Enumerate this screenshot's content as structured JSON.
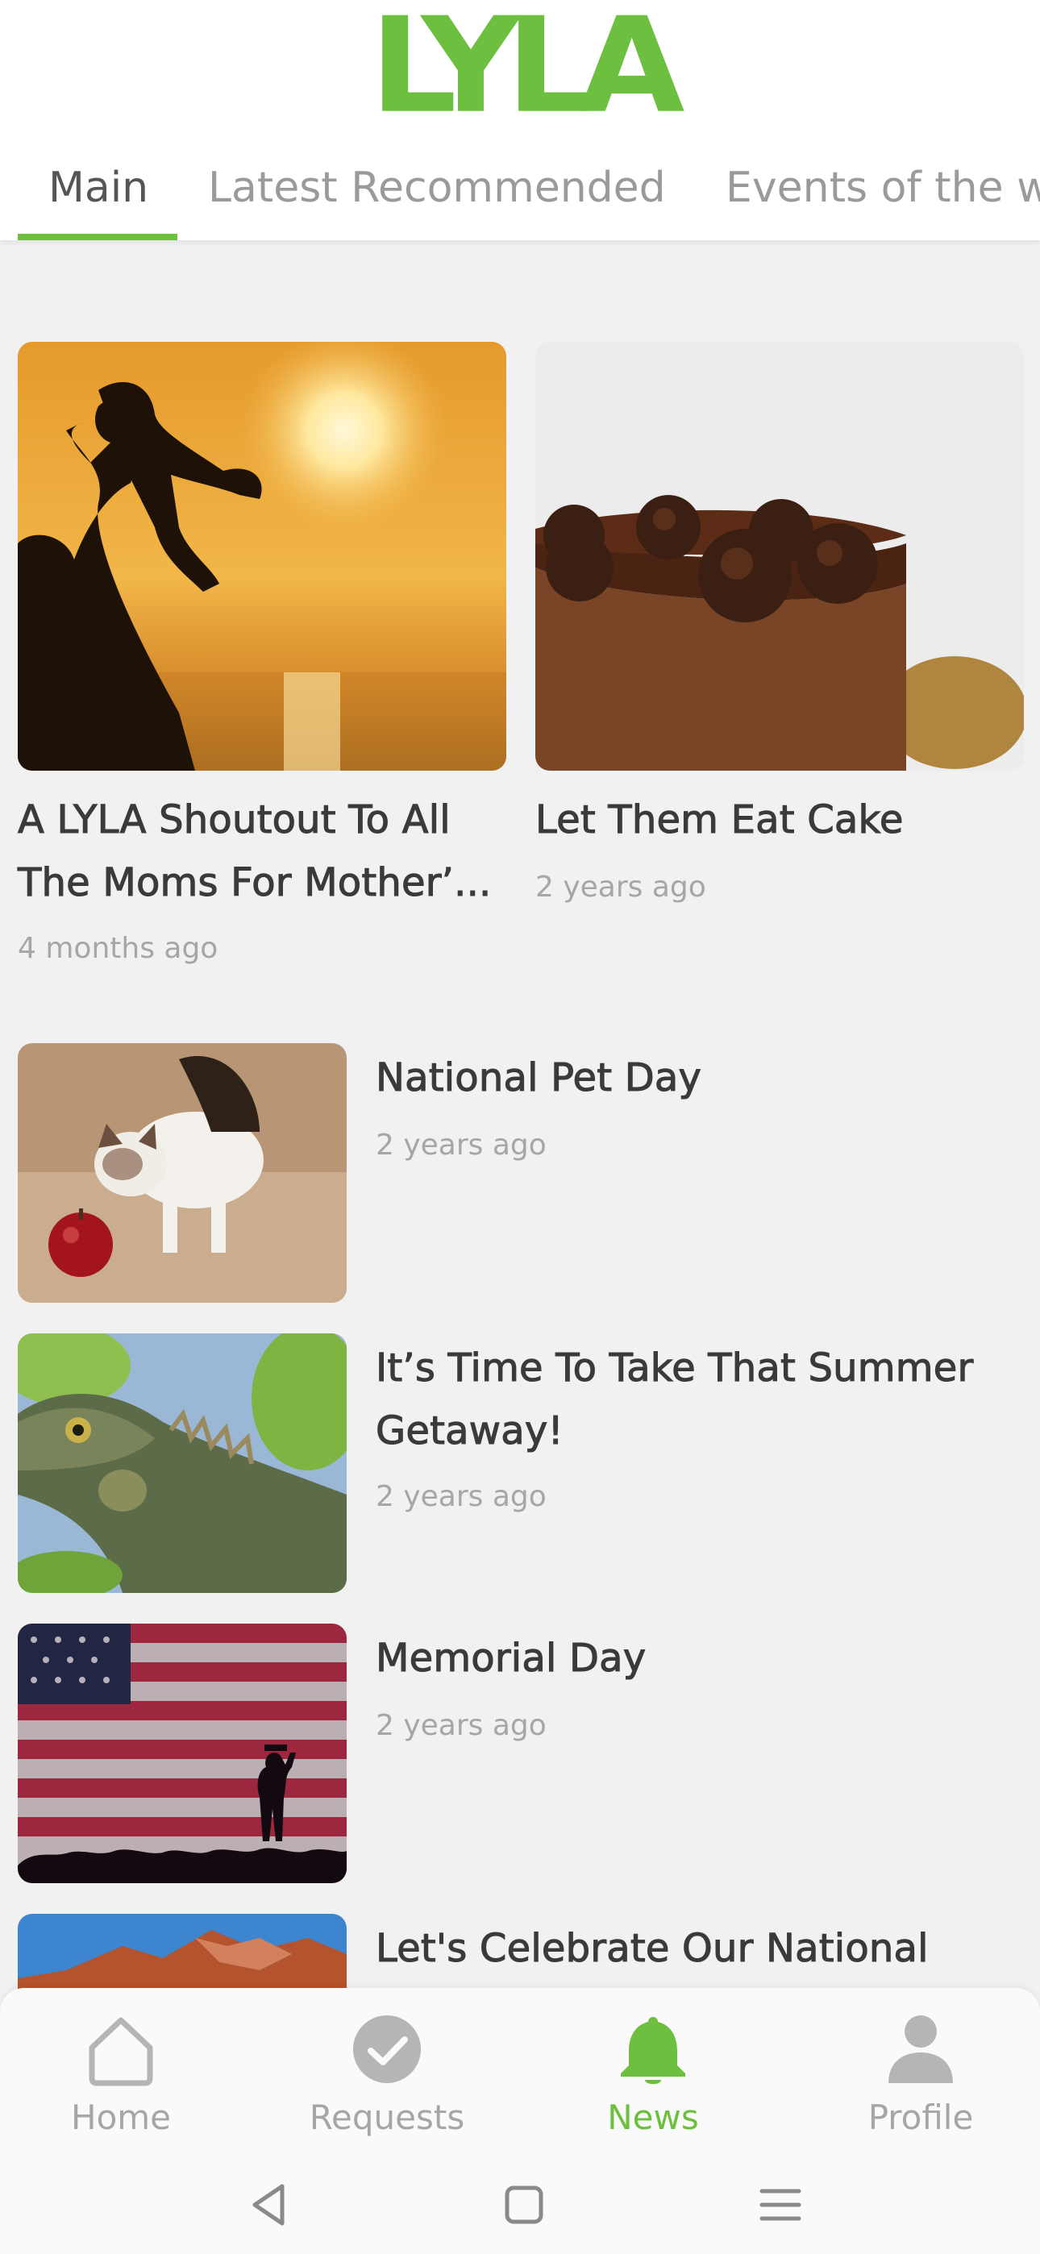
{
  "app": {
    "logo_text": "LYLA",
    "accent_color": "#6cbf3f"
  },
  "tabs": [
    {
      "label": "Main",
      "active": true
    },
    {
      "label": "Latest Recommended",
      "active": false
    },
    {
      "label": "Events of the w",
      "active": false
    }
  ],
  "featured": [
    {
      "title_line1": "A LYLA Shoutout To All",
      "title_line2": "The Moms For Mother’...",
      "date": "4 months ago",
      "image": "mother-child-sunset"
    },
    {
      "title_line1": "Let Them Eat Cake",
      "date": "2 years ago",
      "image": "chocolate-cake"
    }
  ],
  "list": [
    {
      "title_line1": "National Pet Day",
      "date": "2 years ago",
      "image": "kitten-apple"
    },
    {
      "title_line1": "It’s Time To Take That Summer",
      "title_line2": "Getaway!",
      "date": "2 years ago",
      "image": "iguana"
    },
    {
      "title_line1": "Memorial Day",
      "date": "2 years ago",
      "image": "flag-salute"
    },
    {
      "title_line1": "Let's Celebrate Our National",
      "image": "mountain"
    }
  ],
  "bottom_nav": [
    {
      "label": "Home",
      "icon": "home-icon",
      "active": false
    },
    {
      "label": "Requests",
      "icon": "check-circle-icon",
      "active": false
    },
    {
      "label": "News",
      "icon": "bell-icon",
      "active": true
    },
    {
      "label": "Profile",
      "icon": "person-icon",
      "active": false
    }
  ],
  "system_nav": [
    "back-icon",
    "recents-square-icon",
    "menu-icon"
  ]
}
